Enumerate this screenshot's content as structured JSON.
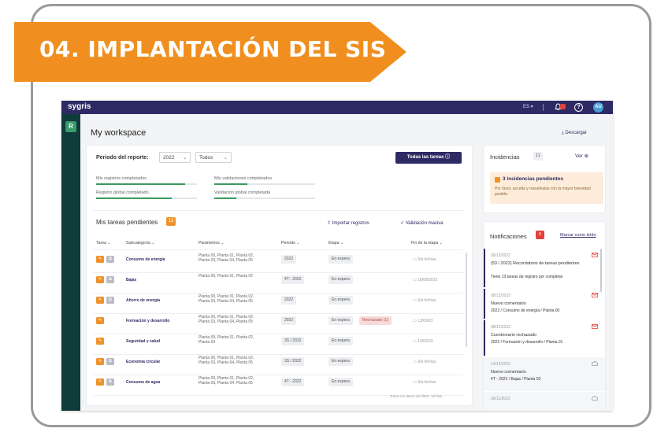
{
  "banner": {
    "title": "04. IMPLANTACIÓN DEL SIS",
    "color": "#f08f1f"
  },
  "app": {
    "logo": "sygris",
    "lang": "ES ▾",
    "avatar": "AU",
    "sidebar_button": "R",
    "workspace_title": "My workspace",
    "download": "⤓ Descargar",
    "report": {
      "period_label": "Periodo del reporte:",
      "year": "2022",
      "filter": "Todos",
      "button": "Todas las tareas ⓘ",
      "progress": [
        {
          "label": "Mis registros completados",
          "value": 0.88
        },
        {
          "label": "Mis validaciones completados",
          "value": 0.33
        },
        {
          "label": "Registro global completado",
          "value": 0.75
        },
        {
          "label": "Validación global completada",
          "value": 0.22
        }
      ]
    },
    "pending": {
      "title": "Mis tareas pendientes",
      "count": "13",
      "import": "⇪ Importar registros",
      "validate": "✓ Validación masiva",
      "columns": [
        "Tarea",
        "Subcategoría",
        "Parámetros",
        "Periodo",
        "Etapa",
        "Fin de la etapa"
      ],
      "rows": [
        {
          "subcategory": "Consumo de energía",
          "plants": [
            "Planta 00, Planta 01, Planta 02,",
            "Planta 03, Planta 04, Planta 05"
          ],
          "period": "2022",
          "stage": "En espera",
          "extra": "",
          "end": "Sin fechas",
          "grey": true
        },
        {
          "subcategory": "Bajas",
          "plants": [
            "Planta 00, Planta 01, Planta 02"
          ],
          "period": "4T - 2022",
          "stage": "En espera",
          "extra": "",
          "end": "18/09/2023",
          "grey": true
        },
        {
          "subcategory": "Ahorro de energía",
          "plants": [
            "Planta 00, Planta 01, Planta 02,",
            "Planta 03, Planta 04, Planta 05"
          ],
          "period": "2022",
          "stage": "En espera",
          "extra": "",
          "end": "Sin fechas",
          "grey": true
        },
        {
          "subcategory": "Formación y desarrollo",
          "plants": [
            "Planta 00, Planta 01, Planta 02,",
            "Planta 03, Planta 04, Planta 05"
          ],
          "period": "2022",
          "stage": "En espera",
          "extra": "Rechazado (1)",
          "end": "13/09/23",
          "grey": false
        },
        {
          "subcategory": "Seguridad y salud",
          "plants": [
            "Planta 00, Planta 01, Planta 02,",
            "Planta 03"
          ],
          "period": "3S / 2022",
          "stage": "En espera",
          "extra": "",
          "end": "13/09/23",
          "grey": false
        },
        {
          "subcategory": "Economía circular",
          "plants": [
            "Planta 00, Planta 01, Planta 02,",
            "Planta 03, Planta 04, Planta 05"
          ],
          "period": "3S / 2022",
          "stage": "En espera",
          "extra": "",
          "end": "Sin fechas",
          "grey": true
        },
        {
          "subcategory": "Consumo de agua",
          "plants": [
            "Planta 00, Planta 01, Planta 02,",
            "Planta 03, Planta 04, Planta 05"
          ],
          "period": "4T - 2022",
          "stage": "En espera",
          "extra": "",
          "end": "Sin fechas",
          "grey": true
        }
      ],
      "footer": "Todos los datos sin filtrar: 18 filas"
    },
    "incidents": {
      "title": "Incidencias",
      "count": "11",
      "view": "Ver ⊕",
      "alert_title": "3 incidencias pendientes",
      "alert_text": "Por favor, acceda y resuélvalas con la mayor brevedad posible."
    },
    "notifications": {
      "title": "Notificaciones",
      "count": "5",
      "mark_read": "Marcar como leído",
      "items": [
        {
          "date": "09/12/2022",
          "title": "(53 / 2022) Recordatorio de tareas pendientes",
          "subtitle": "Tiene 13 tareas de registro por completar",
          "unread": true
        },
        {
          "date": "08/12/2022",
          "title": "Nuevo comentario",
          "subtitle": "2022 / Consumo de energía / Planta 00",
          "unread": true
        },
        {
          "date": "08/12/2022",
          "title": "Cuestionario rechazado",
          "subtitle": "2022 / Formación y desarrollo / Planta 01",
          "unread": true
        },
        {
          "date": "14/12/2022",
          "title": "Nuevo comentario",
          "subtitle": "4T - 2022 / Bajas / Planta 03",
          "unread": false
        },
        {
          "date": "30/11/2022",
          "title": "",
          "subtitle": "",
          "unread": false
        }
      ]
    }
  }
}
